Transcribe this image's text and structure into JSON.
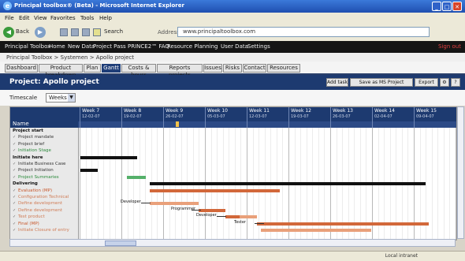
{
  "window": {
    "title": "Principal toolbox® (Beta) - Microsoft Internet Explorer"
  },
  "menu": [
    "File",
    "Edit",
    "View",
    "Favorites",
    "Tools",
    "Help"
  ],
  "toolbar": {
    "back": "Back",
    "search": "Search",
    "address_label": "Address",
    "address": "www.principaltoolbox.com"
  },
  "appnav": [
    "Principal Toolbox",
    "Home",
    "New Data",
    "Project Pass",
    "PRINCE2™ FAQ",
    "Resource Planning",
    "User Data",
    "Settings"
  ],
  "appnav_logout": "Sign out",
  "breadcrumb": "Principal Toolbox > Systemen > Apollo project",
  "tabs": [
    "Dashboard",
    "Product breakdown",
    "Plan",
    "Gantt",
    "Costs & hours",
    "Reports projects",
    "Issues",
    "Risks",
    "Contact",
    "Resources"
  ],
  "project": {
    "title": "Project: Apollo project",
    "buttons": [
      "Add task",
      "Save as MS Project",
      "Export",
      "⚙",
      "?"
    ]
  },
  "filter": {
    "label": "Timescale",
    "value": "Weeks"
  },
  "gantt": {
    "task_header": "Name",
    "weeks": [
      {
        "label": "Week 7",
        "date": "12-02-07"
      },
      {
        "label": "Week 8",
        "date": "19-02-07"
      },
      {
        "label": "Week 9",
        "date": "26-02-07"
      },
      {
        "label": "Week 10",
        "date": "05-03-07"
      },
      {
        "label": "Week 11",
        "date": "12-03-07"
      },
      {
        "label": "Week 12",
        "date": "19-03-07"
      },
      {
        "label": "Week 13",
        "date": "26-03-07"
      },
      {
        "label": "Week 14",
        "date": "02-04-07"
      },
      {
        "label": "Week 15",
        "date": "09-04-07"
      }
    ],
    "rows": [
      {
        "text": "Project start",
        "kind": "phase"
      },
      {
        "text": "Project mandate",
        "kind": "sub"
      },
      {
        "text": "Project brief",
        "kind": "sub"
      },
      {
        "text": "Initiation Stage",
        "kind": "sub green"
      },
      {
        "text": "Initiate here",
        "kind": "phase"
      },
      {
        "text": "Initiate Business Case",
        "kind": "sub"
      },
      {
        "text": "Project Initiation",
        "kind": "sub"
      },
      {
        "text": "Project Summaries",
        "kind": "sub green"
      },
      {
        "text": "Delivering",
        "kind": "phase"
      },
      {
        "text": "Evaluation (MP)",
        "kind": "sub orange"
      },
      {
        "text": "Configuration Technical",
        "kind": "sub dim"
      },
      {
        "text": "Define development",
        "kind": "sub dim"
      },
      {
        "text": "Define development",
        "kind": "sub dim"
      },
      {
        "text": "Test product",
        "kind": "sub dim"
      },
      {
        "text": "Final (MP)",
        "kind": "sub orange"
      },
      {
        "text": "Initiate Closure of entry",
        "kind": "sub dim"
      }
    ],
    "bar_labels": [
      "Developer",
      "Programmer",
      "Developer",
      "Tester"
    ]
  },
  "status": {
    "zone": "Local intranet"
  }
}
